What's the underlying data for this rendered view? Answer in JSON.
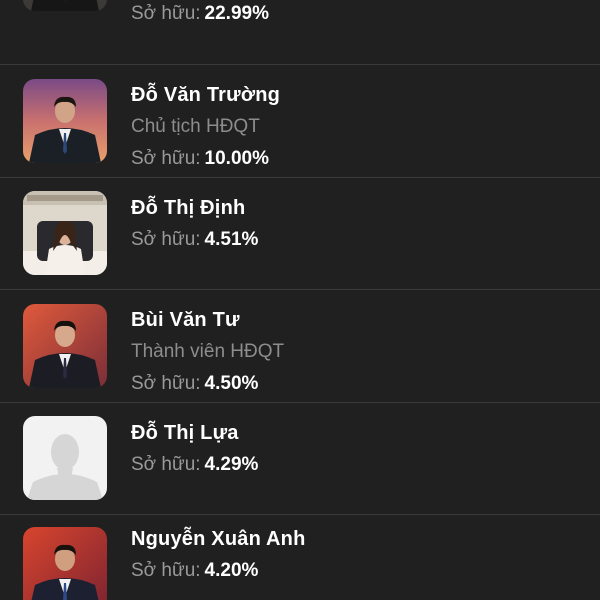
{
  "shareholders": [
    {
      "name": "",
      "role": "",
      "ownership_label": "Sở hữu:",
      "ownership_value": "22.99%",
      "avatar_icon": "person-photo-icon"
    },
    {
      "name": "Đỗ Văn Trường",
      "role": "Chủ tịch HĐQT",
      "ownership_label": "Sở hữu:",
      "ownership_value": "10.00%",
      "avatar_icon": "person-photo-icon"
    },
    {
      "name": "Đỗ Thị Định",
      "role": "",
      "ownership_label": "Sở hữu:",
      "ownership_value": "4.51%",
      "avatar_icon": "person-photo-icon"
    },
    {
      "name": "Bùi Văn Tư",
      "role": "Thành viên HĐQT",
      "ownership_label": "Sở hữu:",
      "ownership_value": "4.50%",
      "avatar_icon": "person-photo-icon"
    },
    {
      "name": "Đỗ Thị Lựa",
      "role": "",
      "ownership_label": "Sở hữu:",
      "ownership_value": "4.29%",
      "avatar_icon": "default-avatar-icon"
    },
    {
      "name": "Nguyễn Xuân Anh",
      "role": "",
      "ownership_label": "Sở hữu:",
      "ownership_value": "4.20%",
      "avatar_icon": "person-photo-icon"
    }
  ],
  "colors": {
    "background": "#202020",
    "divider": "#3a3a3a",
    "name_text": "#ffffff",
    "secondary_text": "#8d8d8d"
  }
}
